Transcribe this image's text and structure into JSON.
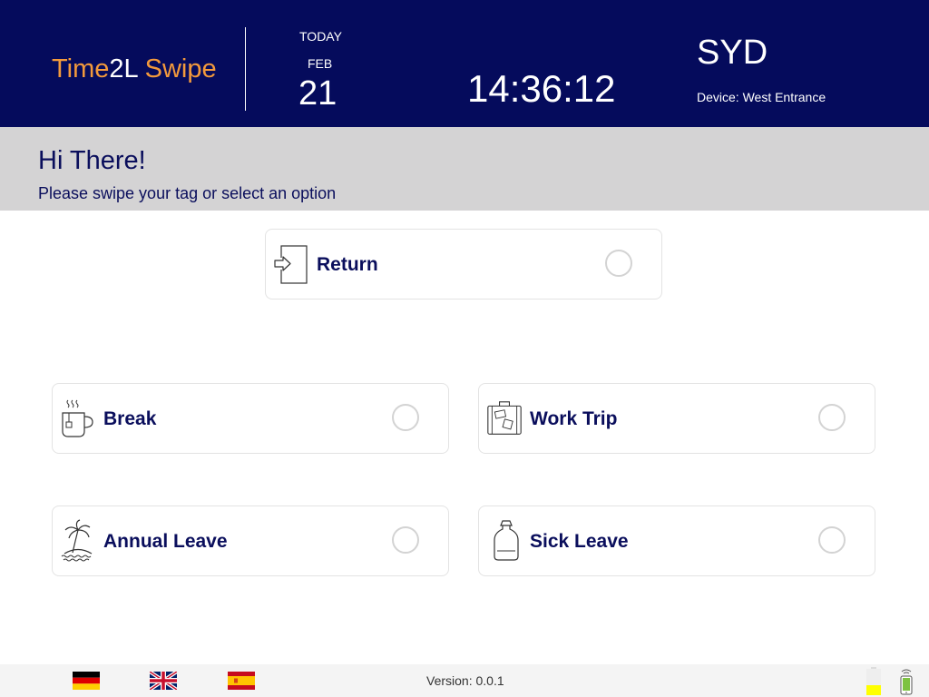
{
  "header": {
    "logo": {
      "part1": "Time",
      "part2": "2L",
      "part3": " Swipe"
    },
    "today_label": "TODAY",
    "month": "FEB",
    "day": "21",
    "time": "14:36:12",
    "site": "SYD",
    "device": "Device: West Entrance"
  },
  "greeting": {
    "title": "Hi There!",
    "subtitle": "Please swipe your tag or select an option"
  },
  "options": {
    "return": {
      "label": "Return",
      "icon": "enter-door-icon",
      "selected": false
    },
    "break": {
      "label": "Break",
      "icon": "coffee-cup-icon",
      "selected": false
    },
    "work_trip": {
      "label": "Work Trip",
      "icon": "suitcase-icon",
      "selected": false
    },
    "annual_leave": {
      "label": "Annual Leave",
      "icon": "palm-island-icon",
      "selected": false
    },
    "sick_leave": {
      "label": "Sick Leave",
      "icon": "hot-water-bottle-icon",
      "selected": false
    }
  },
  "footer": {
    "languages": [
      "German",
      "English",
      "Spanish"
    ],
    "version": "Version: 0.0.1",
    "battery_level": 0.35,
    "battery_color": "#ffff00"
  },
  "colors": {
    "header_bg": "#050b5c",
    "accent": "#f39a3c",
    "greeting_bg": "#d4d3d4",
    "text": "#0a0e5c"
  }
}
